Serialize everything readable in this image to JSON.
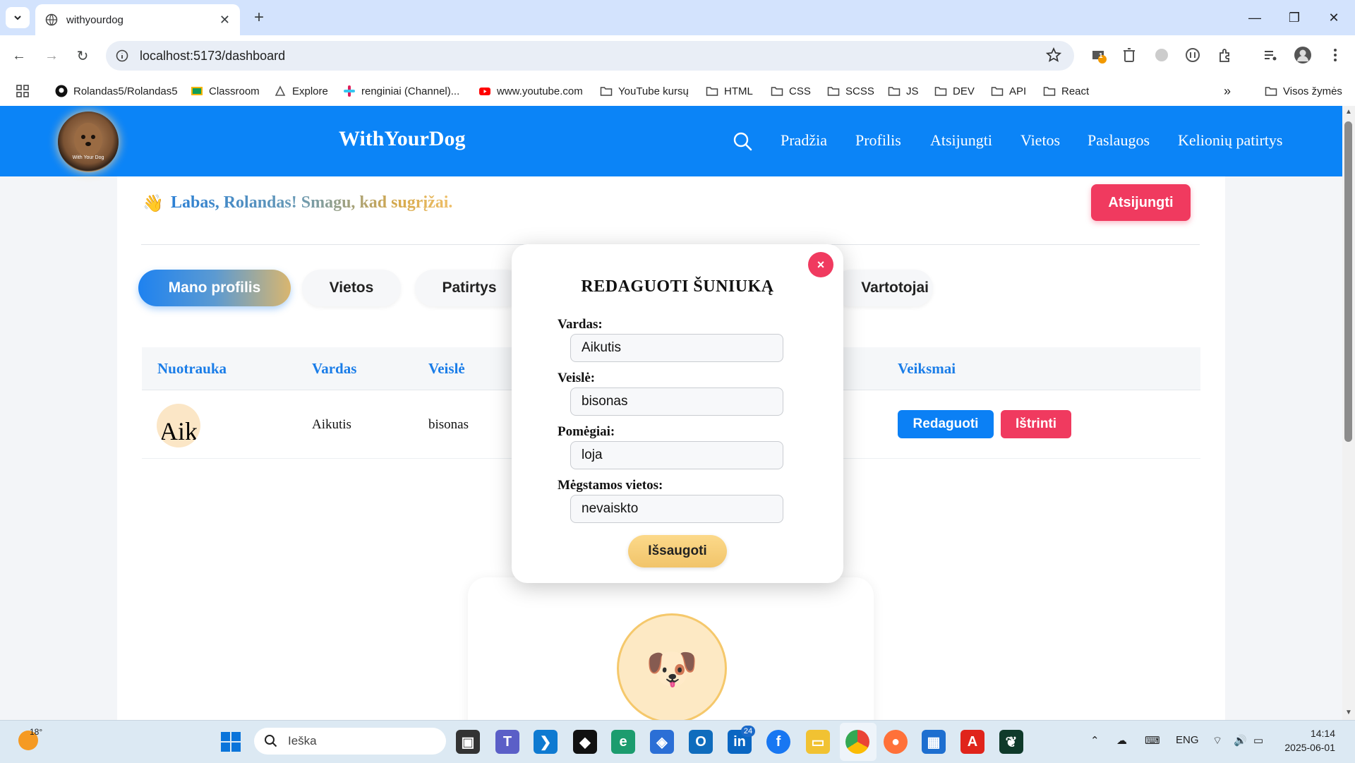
{
  "browser": {
    "tab_title": "withyourdog",
    "url": "localhost:5173/dashboard",
    "bookmarks": [
      {
        "label": "Rolandas5/Rolandas5",
        "icon": "github-icon"
      },
      {
        "label": "Classroom",
        "icon": "classroom-icon"
      },
      {
        "label": "Explore",
        "icon": "explore-icon"
      },
      {
        "label": "renginiai (Channel)...",
        "icon": "slack-icon"
      },
      {
        "label": "www.youtube.com",
        "icon": "youtube-icon"
      },
      {
        "label": "YouTube kursų",
        "icon": "folder-icon"
      },
      {
        "label": "HTML",
        "icon": "folder-icon"
      },
      {
        "label": "CSS",
        "icon": "folder-icon"
      },
      {
        "label": "SCSS",
        "icon": "folder-icon"
      },
      {
        "label": "JS",
        "icon": "folder-icon"
      },
      {
        "label": "DEV",
        "icon": "folder-icon"
      },
      {
        "label": "API",
        "icon": "folder-icon"
      },
      {
        "label": "React",
        "icon": "folder-icon"
      }
    ],
    "all_bookmarks": "Visos žymės",
    "extension_badge": "1"
  },
  "site": {
    "brand": "WithYourDog",
    "logo_text": "With Your Dog",
    "nav": [
      "Pradžia",
      "Profilis",
      "Atsijungti",
      "Vietos",
      "Paslaugos",
      "Kelionių patirtys"
    ]
  },
  "dashboard": {
    "greeting": "Labas, Rolandas! Smagu, kad sugrįžai.",
    "logout": "Atsijungti",
    "tabs": [
      "Mano profilis",
      "Vietos",
      "Patirtys",
      "Vartotojai"
    ],
    "table": {
      "headers": [
        "Nuotrauka",
        "Vardas",
        "Veislė",
        "Veiksmai"
      ],
      "rows": [
        {
          "photo_alt": "Aik",
          "name": "Aikutis",
          "breed": "bisonas",
          "edit": "Redaguoti",
          "delete": "Ištrinti"
        }
      ]
    },
    "avatar_emoji": "🐶"
  },
  "modal": {
    "title": "REDAGUOTI ŠUNIUKĄ",
    "close": "×",
    "fields": [
      {
        "label": "Vardas:",
        "value": "Aikutis"
      },
      {
        "label": "Veislė:",
        "value": "bisonas"
      },
      {
        "label": "Pomėgiai:",
        "value": "loja"
      },
      {
        "label": "Mėgstamos vietos:",
        "value": "nevaiskto"
      }
    ],
    "save": "Išsaugoti"
  },
  "taskbar": {
    "weather": "18°",
    "search_placeholder": "Ieška",
    "language": "ENG",
    "time": "14:14",
    "date": "2025-06-01",
    "linkedin_badge": "24"
  },
  "colors": {
    "header_blue": "#0b84f7",
    "accent_red": "#f03a5f",
    "accent_gold": "#f1c46a",
    "tab_strip": "#d3e3fd"
  }
}
